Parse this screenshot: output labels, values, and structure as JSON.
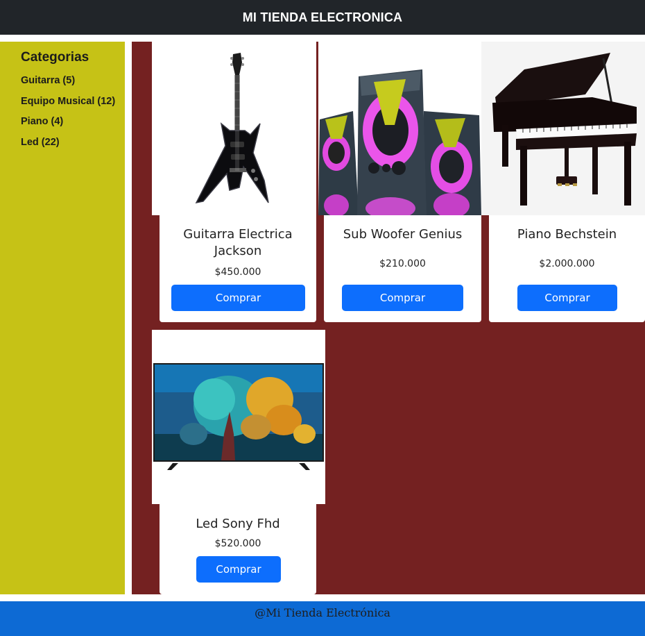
{
  "header": {
    "title": "MI TIENDA ELECTRONICA"
  },
  "sidebar": {
    "heading": "Categorias",
    "items": [
      {
        "label": "Guitarra (5)"
      },
      {
        "label": "Equipo Musical (12)"
      },
      {
        "label": "Piano (4)"
      },
      {
        "label": "Led (22)"
      }
    ]
  },
  "products": [
    {
      "name": "Guitarra Electrica Jackson",
      "price": "$450.000",
      "button": "Comprar",
      "image": "guitar-image"
    },
    {
      "name": "Sub Woofer Genius",
      "price": "$210.000",
      "button": "Comprar",
      "image": "speakers-image"
    },
    {
      "name": "Piano Bechstein",
      "price": "$2.000.000",
      "button": "Comprar",
      "image": "piano-image"
    },
    {
      "name": "Led Sony Fhd",
      "price": "$520.000",
      "button": "Comprar",
      "image": "tv-image"
    }
  ],
  "footer": {
    "text": "@Mi Tienda Electrónica"
  },
  "colors": {
    "header_bg": "#212529",
    "sidebar_bg": "#c6c216",
    "main_bg": "#742121",
    "button_bg": "#0d6efd",
    "footer_bg": "#0d6ad4"
  }
}
